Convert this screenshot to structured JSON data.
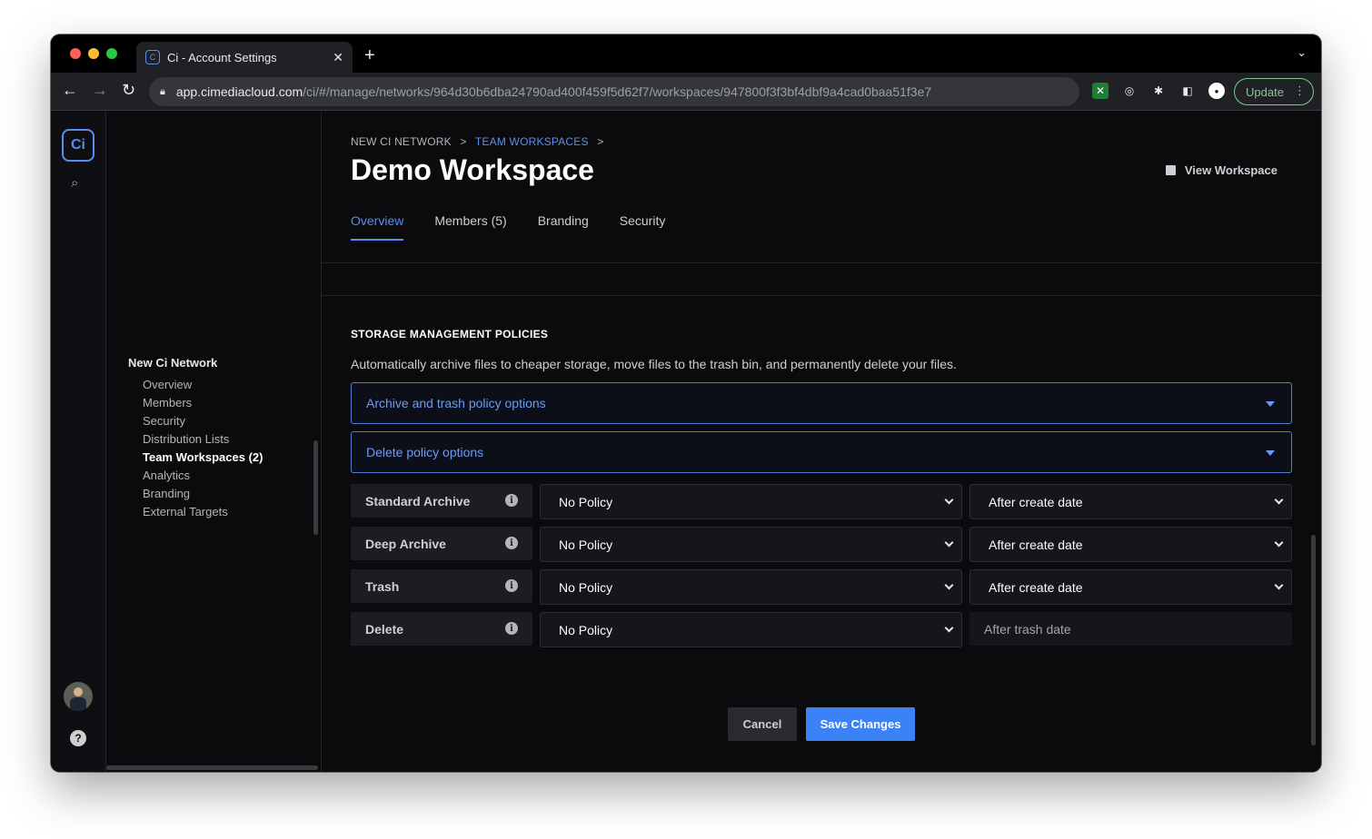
{
  "browser": {
    "tab_title": "Ci - Account Settings",
    "tab_close": "✕",
    "new_tab": "+",
    "url_host": "app.cimediacloud.com",
    "url_path": "/ci/#/manage/networks/964d30b6dba24790ad400f459f5d62f7/workspaces/947800f3f3bf4dbf9a4cad0baa51f3e7",
    "update_label": "Update"
  },
  "rail": {
    "logo_text": "Ci"
  },
  "sidebar": {
    "group_title": "New Ci Network",
    "items": [
      {
        "label": "Overview"
      },
      {
        "label": "Members"
      },
      {
        "label": "Security"
      },
      {
        "label": "Distribution Lists"
      },
      {
        "label": "Team Workspaces (2)"
      },
      {
        "label": "Analytics"
      },
      {
        "label": "Branding"
      },
      {
        "label": "External Targets"
      }
    ],
    "active_index": 4
  },
  "header": {
    "breadcrumb": [
      "NEW CI NETWORK",
      "TEAM WORKSPACES"
    ],
    "breadcrumb_sep": ">",
    "title": "Demo Workspace",
    "view_workspace": "View Workspace",
    "tabs": [
      {
        "label": "Overview"
      },
      {
        "label": "Members (5)"
      },
      {
        "label": "Branding"
      },
      {
        "label": "Security"
      }
    ],
    "active_tab": 0
  },
  "storage": {
    "title": "STORAGE MANAGEMENT POLICIES",
    "description": "Automatically archive files to cheaper storage, move files to the trash bin, and permanently delete your files.",
    "accordion_archive": "Archive and trash policy options",
    "accordion_delete": "Delete policy options",
    "rows": [
      {
        "label": "Standard Archive",
        "policy": "No Policy",
        "date": "After create date"
      },
      {
        "label": "Deep Archive",
        "policy": "No Policy",
        "date": "After create date"
      },
      {
        "label": "Trash",
        "policy": "No Policy",
        "date": "After create date"
      },
      {
        "label": "Delete",
        "policy": "No Policy",
        "date": "After trash date"
      }
    ]
  },
  "actions": {
    "cancel": "Cancel",
    "save": "Save Changes"
  },
  "colors": {
    "accent": "#5b8def",
    "primary_button": "#3b82f6",
    "background": "#0b0b0e"
  }
}
